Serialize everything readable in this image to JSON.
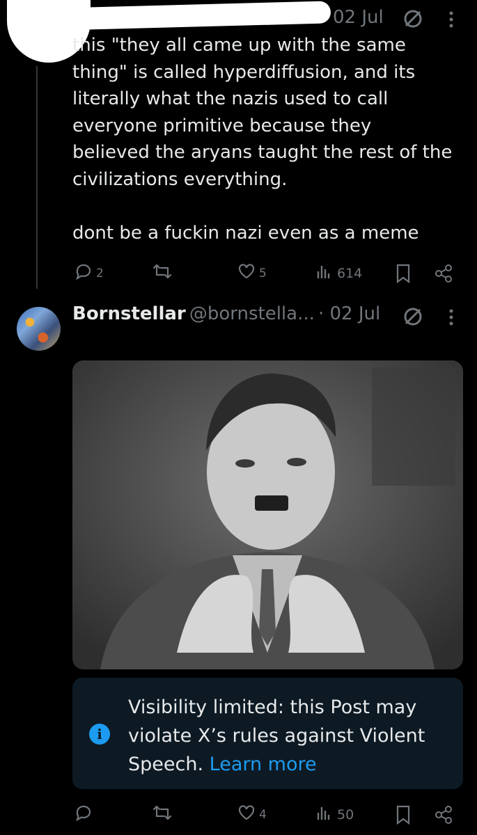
{
  "post1": {
    "date": "02 Jul",
    "text": "this \"they all came up with the same\nthing\" is called hyperdiffusion, and its\nliterally what the nazis used to call\neveryone primitive because they\nbelieved the aryans taught the rest of the\ncivilizations everything.\n\ndont be a fuckin nazi even as a meme",
    "replies": "2",
    "retweets": "",
    "likes": "5",
    "views": "614"
  },
  "post2": {
    "display_name": "Bornstellar",
    "handle": "@bornstella...",
    "date": "· 02 Jul",
    "notice": {
      "text": "Visibility limited: this Post may violate X’s rules against Violent Speech.",
      "link": "Learn more"
    },
    "replies": "",
    "retweets": "",
    "likes": "4",
    "views": "50"
  },
  "icons": {
    "reply": "reply-icon",
    "retweet": "retweet-icon",
    "like": "heart-icon",
    "views": "views-icon",
    "bookmark": "bookmark-icon",
    "share": "share-icon",
    "grok": "grok-icon",
    "more": "more-icon",
    "info": "info-icon"
  },
  "colors": {
    "background": "#000000",
    "text": "#e7e9ea",
    "muted": "#71767b",
    "accent": "#1d9bf0",
    "notice_bg": "#0d1a24"
  }
}
